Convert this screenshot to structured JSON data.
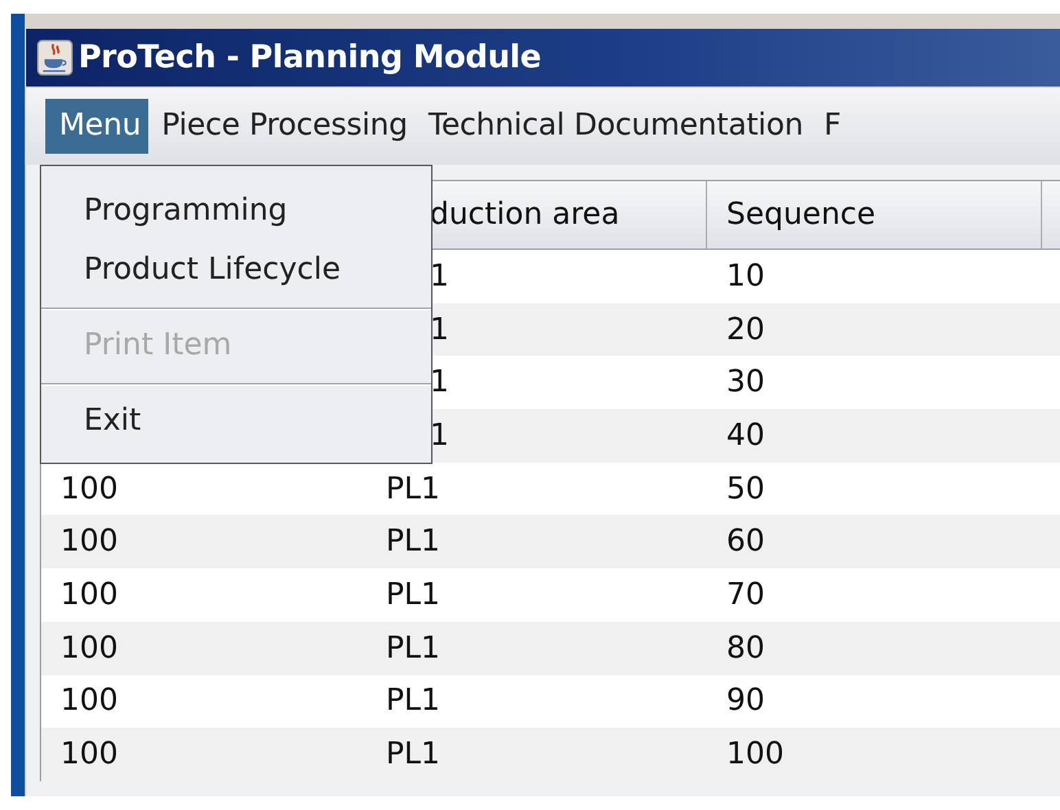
{
  "window": {
    "title": "ProTech - Planning Module"
  },
  "menu_bar": [
    {
      "label": "Menu",
      "selected": true
    },
    {
      "label": "Piece Processing",
      "selected": false
    },
    {
      "label": "Technical Documentation",
      "selected": false
    },
    {
      "label": "F",
      "selected": false
    }
  ],
  "open_menu": {
    "items": [
      {
        "kind": "item",
        "label": "Programming",
        "disabled": false
      },
      {
        "kind": "item",
        "label": "Product Lifecycle",
        "disabled": false
      },
      {
        "kind": "separator"
      },
      {
        "kind": "item",
        "label": "Print Item",
        "disabled": true
      },
      {
        "kind": "separator"
      },
      {
        "kind": "item",
        "label": "Exit",
        "disabled": false
      }
    ]
  },
  "table": {
    "columns": [
      {
        "column_2": "duction area",
        "column_3": "Sequence"
      }
    ],
    "rows": [
      {
        "column_2": "1",
        "column_3": "10"
      },
      {
        "column_2": "1",
        "column_3": "20"
      },
      {
        "column_2": "1",
        "column_3": "30"
      },
      {
        "column_2": "1",
        "column_3": "40"
      },
      {
        "column_1": "100",
        "column_2": "PL1",
        "column_3": "50"
      },
      {
        "column_1": "100",
        "column_2": "PL1",
        "column_3": "60"
      },
      {
        "column_1": "100",
        "column_2": "PL1",
        "column_3": "70"
      },
      {
        "column_1": "100",
        "column_2": "PL1",
        "column_3": "80"
      },
      {
        "column_1": "100",
        "column_2": "PL1",
        "column_3": "90"
      },
      {
        "column_1": "100",
        "column_2": "PL1",
        "column_3": "100"
      }
    ]
  }
}
